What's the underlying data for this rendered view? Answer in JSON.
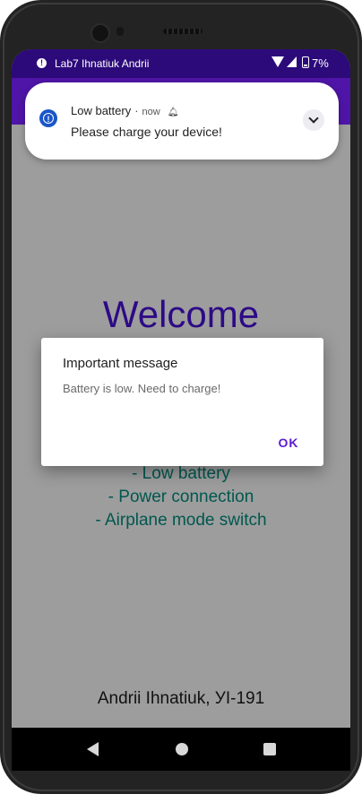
{
  "status_bar": {
    "alert_icon": "alert-circle-icon",
    "title": "Lab7 Ihnatiuk Andrii",
    "battery_percent": "7%"
  },
  "notification": {
    "title": "Low battery",
    "separator": "·",
    "time": "now",
    "body": "Please charge your device!"
  },
  "main": {
    "welcome": "Welcome",
    "features": [
      "- Low battery",
      "- Power connection",
      "- Airplane mode switch"
    ],
    "author": "Andrii Ihnatiuk, УІ-191"
  },
  "dialog": {
    "title": "Important message",
    "message": "Battery is low. Need to charge!",
    "ok_label": "OK"
  },
  "colors": {
    "status_bar": "#2c0a7a",
    "app_bar": "#4f15a8",
    "welcome_text": "#2d0a86",
    "feature_text": "#00574f",
    "dialog_accent": "#5b1bd1"
  }
}
